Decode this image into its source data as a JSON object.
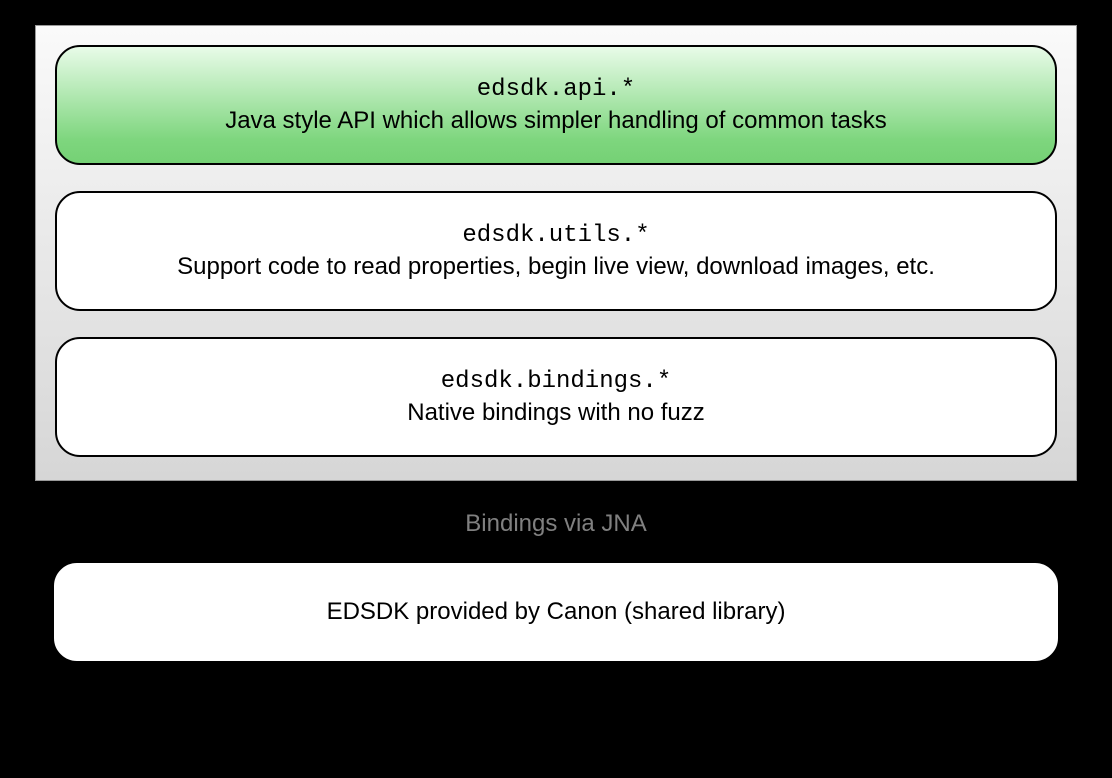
{
  "layers": [
    {
      "code": "edsdk.api.*",
      "desc": "Java style API which allows simpler handling of common tasks",
      "highlighted": true
    },
    {
      "code": "edsdk.utils.*",
      "desc": "Support code to read properties, begin live view, download images, etc.",
      "highlighted": false
    },
    {
      "code": "edsdk.bindings.*",
      "desc": "Native bindings with no fuzz",
      "highlighted": false
    }
  ],
  "connector_label": "Bindings via JNA",
  "bottom_box": "EDSDK provided by Canon (shared library)"
}
